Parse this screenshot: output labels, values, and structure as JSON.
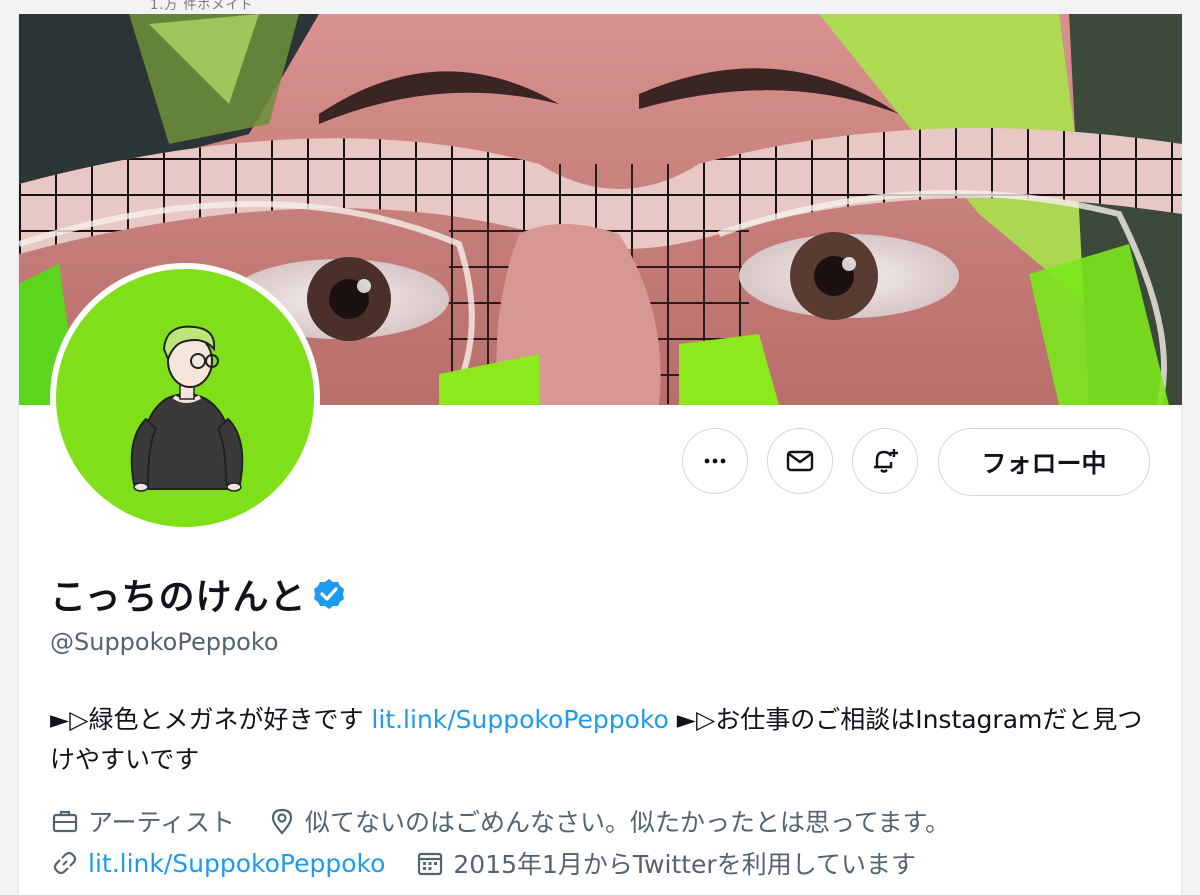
{
  "top_bar": {
    "partial_text": "1.万 件ボメイト"
  },
  "profile": {
    "display_name": "こっちのけんと",
    "handle": "@SuppokoPeppoko",
    "verified_icon": "verified-badge-icon",
    "bio": {
      "part1": "►▷緑色とメガネが好きです ",
      "link1": "lit.link/SuppokoPeppoko",
      "part2": " ►▷お仕事のご相談はInstagramだと見つけやすいです"
    },
    "category": "アーティスト",
    "location": "似てないのはごめんなさい。似たかったとは思ってます。",
    "website": "lit.link/SuppokoPeppoko",
    "joined": "2015年1月からTwitterを利用しています"
  },
  "actions": {
    "more_icon": "more-horizontal-icon",
    "message_icon": "envelope-icon",
    "notify_icon": "bell-plus-icon",
    "follow_label": "フォロー中"
  },
  "colors": {
    "accent": "#1d9bf0",
    "avatar_bg": "#7fe019",
    "secondary_text": "#536471",
    "border": "#cfd9de"
  }
}
